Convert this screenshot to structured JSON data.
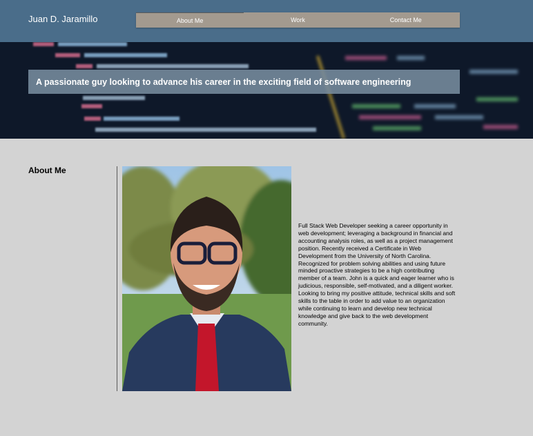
{
  "header": {
    "site_name": "Juan D. Jaramillo",
    "nav": [
      {
        "label": "About Me"
      },
      {
        "label": "Work"
      },
      {
        "label": "Contact Me"
      }
    ]
  },
  "hero": {
    "tagline": "A passionate guy looking to advance his career in the exciting field of software engineering"
  },
  "about": {
    "title": "About Me",
    "bio": "Full Stack Web Developer seeking a career opportunity in web development; leveraging a background in financial and accounting analysis roles, as well as a project management position. Recently received a Certificate in Web Development from the University of North Carolina. Recognized for problem solving abilities and using future minded proactive strategies to be a high contributing member of a team. John is a quick and eager learner who is judicious, responsible, self-motivated, and a diligent worker. Looking to bring my positive attitude, technical skills and soft skills to the table in order to add value to an organization while continuing to learn and develop new technical knowledge and give back to the web development community."
  }
}
